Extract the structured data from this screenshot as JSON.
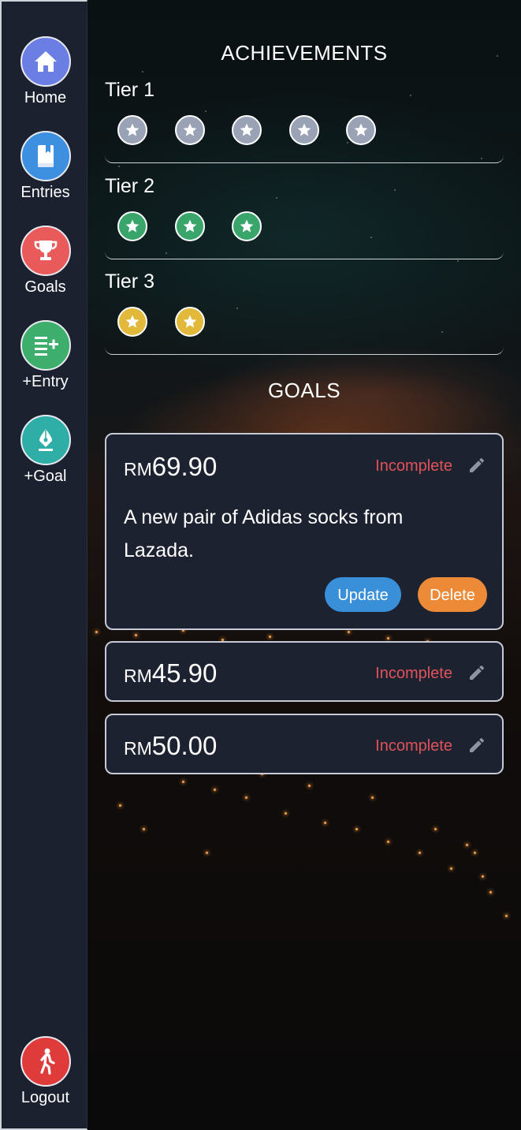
{
  "colors": {
    "sidebar_bg": "#1c2130",
    "home": "#6b7ee3",
    "entries": "#3d8fe0",
    "goals": "#e95a5a",
    "add_entry": "#3dae6b",
    "add_goal": "#2fada7",
    "logout": "#e03b3b",
    "tier1": "#9aa3b5",
    "tier2": "#3aa56a",
    "tier3": "#e3b93c",
    "update_button": "#3a8fd9",
    "delete_button": "#ec8a38",
    "incomplete": "#e0535a"
  },
  "sidebar": {
    "items": [
      {
        "label": "Home",
        "icon": "home-icon"
      },
      {
        "label": "Entries",
        "icon": "book-icon"
      },
      {
        "label": "Goals",
        "icon": "trophy-icon"
      },
      {
        "label": "+Entry",
        "icon": "list-add-icon"
      },
      {
        "label": "+Goal",
        "icon": "pen-nib-icon"
      }
    ],
    "logout": {
      "label": "Logout",
      "icon": "walking-person-icon"
    }
  },
  "achievements": {
    "title": "ACHIEVEMENTS",
    "tiers": [
      {
        "label": "Tier 1",
        "badge_count": 5,
        "icon": "star-icon"
      },
      {
        "label": "Tier 2",
        "badge_count": 3,
        "icon": "star-icon"
      },
      {
        "label": "Tier 3",
        "badge_count": 2,
        "icon": "star-icon"
      }
    ]
  },
  "goals": {
    "title": "GOALS",
    "currency": "RM",
    "items": [
      {
        "amount": "69.90",
        "status": "Incomplete",
        "description": "A new pair of Adidas socks from Lazada.",
        "update_label": "Update",
        "delete_label": "Delete"
      },
      {
        "amount": "45.90",
        "status": "Incomplete"
      },
      {
        "amount": "50.00",
        "status": "Incomplete"
      }
    ]
  }
}
